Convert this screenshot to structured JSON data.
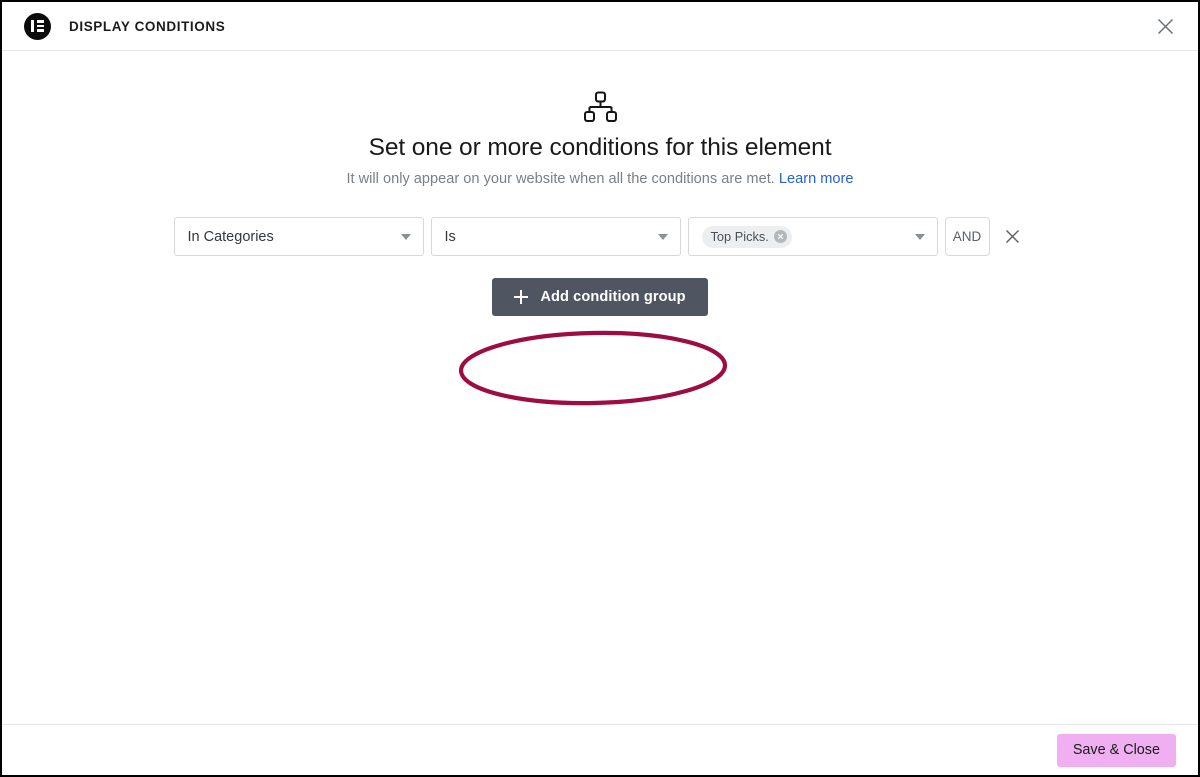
{
  "window": {
    "title": "DISPLAY CONDITIONS",
    "brand_icon": "elementor-logo-icon",
    "close_icon": "close-icon"
  },
  "intro": {
    "icon": "sitemap-icon",
    "headline": "Set one or more conditions for this element",
    "subtext": "It will only appear on your website when all the conditions are met.",
    "learn_more_label": "Learn more",
    "link_color": "#2563d4"
  },
  "condition_row": {
    "type_select": {
      "value": "In Categories",
      "caret_icon": "chevron-down-icon"
    },
    "operator_select": {
      "value": "Is",
      "caret_icon": "chevron-down-icon"
    },
    "value_select": {
      "chips": [
        {
          "label": "Top Picks.",
          "remove_icon": "chip-remove-icon"
        }
      ],
      "caret_icon": "chevron-down-icon"
    },
    "logic_operator": "AND",
    "remove_icon": "remove-condition-icon"
  },
  "actions": {
    "add_condition_group_label": "Add condition group",
    "add_icon": "plus-icon",
    "add_button_color": "#4f5661"
  },
  "footer": {
    "save_close_label": "Save & Close",
    "save_close_color": "#efaff0"
  },
  "annotation": {
    "shape": "ellipse-highlight",
    "color": "#9e0c44",
    "target": "Add condition group"
  }
}
